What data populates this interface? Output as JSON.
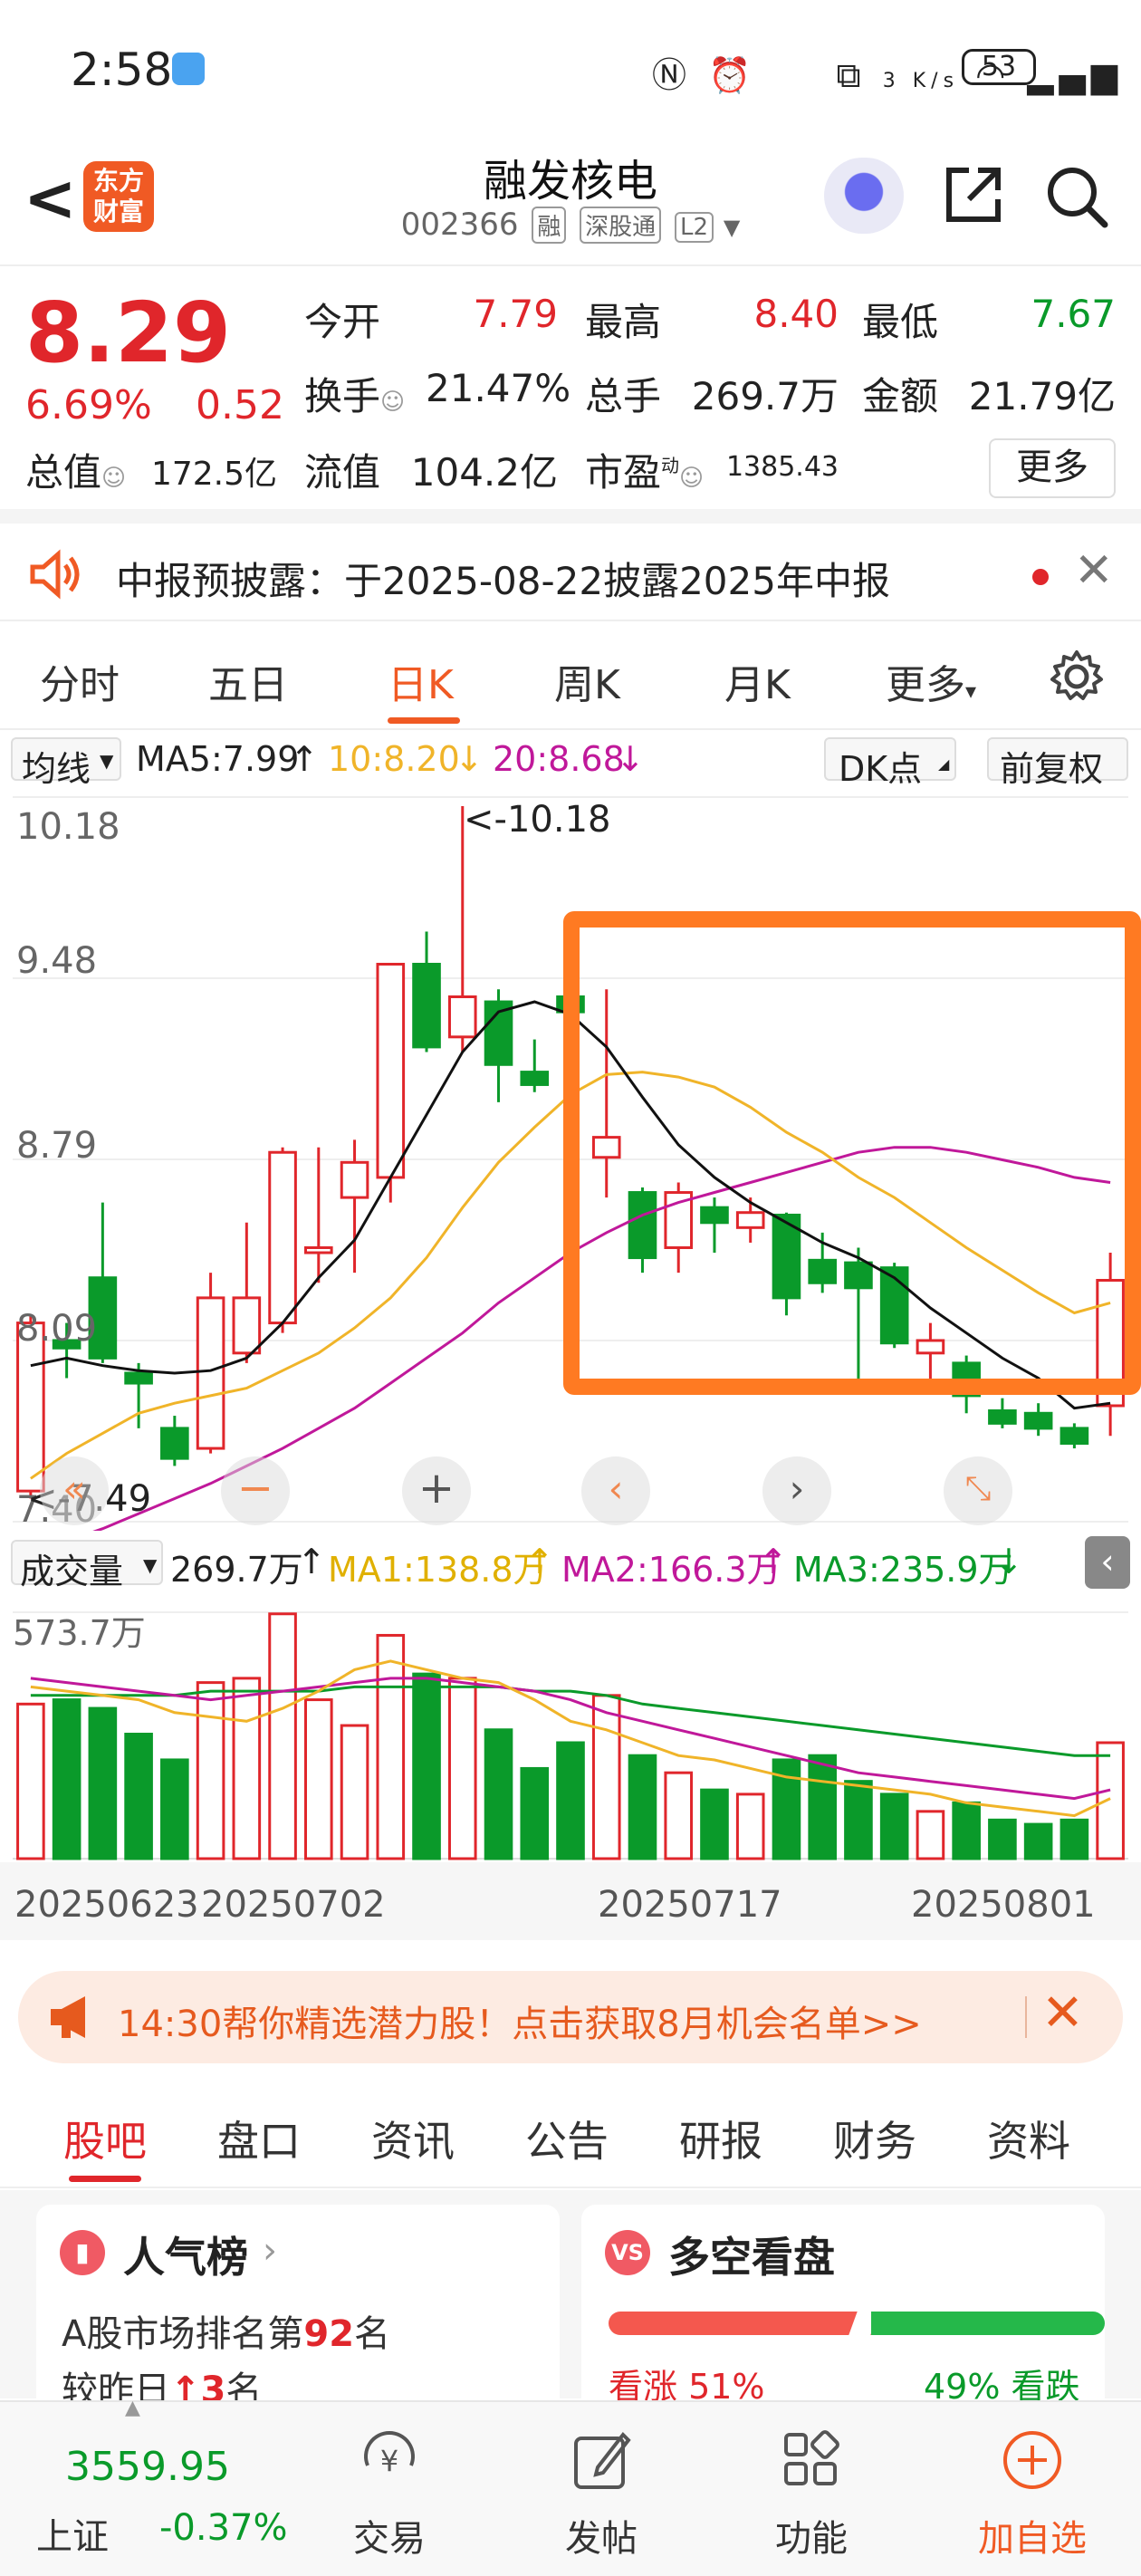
{
  "status_bar": {
    "time": "2:58",
    "net": "3 K/s",
    "battery": "53"
  },
  "header": {
    "logo": "东方财富",
    "title": "融发核电",
    "code": "002366",
    "tags": [
      "融",
      "深股通",
      "L2"
    ]
  },
  "quote": {
    "price": "8.29",
    "change_pct": "6.69%",
    "change": "0.52",
    "rows": [
      [
        {
          "label": "今开",
          "value": "7.79",
          "color": "red"
        },
        {
          "label": "最高",
          "value": "8.40",
          "color": "red"
        },
        {
          "label": "最低",
          "value": "7.67",
          "color": "green"
        }
      ],
      [
        {
          "label": "换手",
          "value": "21.47%"
        },
        {
          "label": "总手",
          "value": "269.7万"
        },
        {
          "label": "金额",
          "value": "21.79亿"
        }
      ],
      [
        {
          "label": "总值",
          "value": "172.5亿"
        },
        {
          "label": "流值",
          "value": "104.2亿"
        },
        {
          "label": "市盈",
          "value": "1385.43",
          "sup": "动"
        }
      ]
    ],
    "more": "更多"
  },
  "notice": {
    "text": "中报预披露：于2025-08-22披露2025年中报"
  },
  "ktabs": [
    "分时",
    "五日",
    "日K",
    "周K",
    "月K",
    "更多"
  ],
  "ma": {
    "selector": "均线",
    "ma5": "MA5:7.99",
    "ma10": "10:8.20",
    "ma20": "20:8.68",
    "dk": "DK点",
    "adj": "前复权"
  },
  "chart_labels": {
    "p1": "10.18",
    "p2": "9.48",
    "p3": "8.79",
    "p4": "8.09",
    "p5": "7.40",
    "hi": "<-10.18",
    "lo": "<-7.49"
  },
  "vol": {
    "selector": "成交量",
    "value": "269.7万",
    "ma1": "MA1:138.8万",
    "ma2": "MA2:166.3万",
    "ma3": "MA3:235.9万",
    "max": "573.7万"
  },
  "dates": [
    "20250623",
    "20250702",
    "20250717",
    "20250801"
  ],
  "colors": {
    "up": "#e0262b",
    "down": "#0a9a2a",
    "ma5": "#111111",
    "ma10": "#f0b429",
    "ma20": "#c0189a",
    "highlight": "#ff7a22"
  },
  "chart_data": {
    "type": "candlestick",
    "candles": [
      {
        "o": 7.45,
        "h": 8.15,
        "l": 7.42,
        "c": 8.12
      },
      {
        "o": 8.05,
        "h": 8.12,
        "l": 7.9,
        "c": 8.02
      },
      {
        "o": 8.3,
        "h": 8.6,
        "l": 7.96,
        "c": 7.98
      },
      {
        "o": 7.92,
        "h": 7.96,
        "l": 7.7,
        "c": 7.88
      },
      {
        "o": 7.7,
        "h": 7.75,
        "l": 7.55,
        "c": 7.58
      },
      {
        "o": 7.62,
        "h": 8.32,
        "l": 7.6,
        "c": 8.22
      },
      {
        "o": 8.0,
        "h": 8.52,
        "l": 7.96,
        "c": 8.22
      },
      {
        "o": 8.12,
        "h": 8.82,
        "l": 8.08,
        "c": 8.8
      },
      {
        "o": 8.4,
        "h": 8.82,
        "l": 8.28,
        "c": 8.42
      },
      {
        "o": 8.62,
        "h": 8.85,
        "l": 8.32,
        "c": 8.76
      },
      {
        "o": 8.7,
        "h": 9.55,
        "l": 8.6,
        "c": 9.55
      },
      {
        "o": 9.55,
        "h": 9.68,
        "l": 9.2,
        "c": 9.22
      },
      {
        "o": 9.26,
        "h": 10.18,
        "l": 9.2,
        "c": 9.42
      },
      {
        "o": 9.4,
        "h": 9.45,
        "l": 9.0,
        "c": 9.15
      },
      {
        "o": 9.12,
        "h": 9.25,
        "l": 9.04,
        "c": 9.07
      },
      {
        "o": 9.42,
        "h": 9.62,
        "l": 9.2,
        "c": 9.36
      },
      {
        "o": 8.78,
        "h": 9.45,
        "l": 8.62,
        "c": 8.86
      },
      {
        "o": 8.64,
        "h": 8.66,
        "l": 8.32,
        "c": 8.38
      },
      {
        "o": 8.42,
        "h": 8.68,
        "l": 8.32,
        "c": 8.64
      },
      {
        "o": 8.58,
        "h": 8.62,
        "l": 8.4,
        "c": 8.52
      },
      {
        "o": 8.5,
        "h": 8.62,
        "l": 8.44,
        "c": 8.56
      },
      {
        "o": 8.55,
        "h": 8.56,
        "l": 8.15,
        "c": 8.22
      },
      {
        "o": 8.37,
        "h": 8.48,
        "l": 8.24,
        "c": 8.28
      },
      {
        "o": 8.36,
        "h": 8.42,
        "l": 7.87,
        "c": 8.26
      },
      {
        "o": 8.34,
        "h": 8.36,
        "l": 8.02,
        "c": 8.04
      },
      {
        "o": 8.0,
        "h": 8.12,
        "l": 7.84,
        "c": 8.05
      },
      {
        "o": 7.96,
        "h": 7.99,
        "l": 7.76,
        "c": 7.83
      },
      {
        "o": 7.77,
        "h": 7.82,
        "l": 7.7,
        "c": 7.72
      },
      {
        "o": 7.76,
        "h": 7.8,
        "l": 7.67,
        "c": 7.7
      },
      {
        "o": 7.7,
        "h": 7.72,
        "l": 7.62,
        "c": 7.64
      },
      {
        "o": 7.79,
        "h": 8.4,
        "l": 7.67,
        "c": 8.29
      }
    ],
    "ma5": [
      7.95,
      7.98,
      7.95,
      7.93,
      7.92,
      7.93,
      7.98,
      8.12,
      8.3,
      8.45,
      8.7,
      8.95,
      9.2,
      9.36,
      9.4,
      9.35,
      9.22,
      9.02,
      8.83,
      8.7,
      8.6,
      8.52,
      8.44,
      8.38,
      8.3,
      8.18,
      8.08,
      7.98,
      7.9,
      7.78,
      7.8
    ],
    "ma10": [
      7.5,
      7.6,
      7.68,
      7.76,
      7.8,
      7.83,
      7.86,
      7.93,
      8.0,
      8.1,
      8.22,
      8.38,
      8.58,
      8.76,
      8.9,
      9.03,
      9.11,
      9.12,
      9.1,
      9.06,
      8.98,
      8.88,
      8.8,
      8.7,
      8.62,
      8.52,
      8.42,
      8.33,
      8.24,
      8.16,
      8.2
    ],
    "ma20": [
      7.2,
      7.25,
      7.3,
      7.36,
      7.42,
      7.48,
      7.55,
      7.62,
      7.7,
      7.78,
      7.88,
      7.98,
      8.08,
      8.2,
      8.3,
      8.4,
      8.48,
      8.55,
      8.6,
      8.64,
      8.68,
      8.72,
      8.76,
      8.8,
      8.82,
      8.82,
      8.8,
      8.77,
      8.74,
      8.7,
      8.68
    ],
    "volumes": [
      3.6,
      3.7,
      3.5,
      2.9,
      2.3,
      4.1,
      4.2,
      5.7,
      3.7,
      3.1,
      5.2,
      4.3,
      4.2,
      3.0,
      2.1,
      2.7,
      3.8,
      2.4,
      2.0,
      1.6,
      1.5,
      2.3,
      2.4,
      1.8,
      1.5,
      1.1,
      1.3,
      0.9,
      0.8,
      0.9,
      2.7
    ],
    "vol_ma1": [
      4.0,
      3.9,
      3.8,
      3.7,
      3.4,
      3.3,
      3.2,
      3.5,
      3.9,
      4.4,
      4.6,
      4.4,
      4.2,
      4.1,
      3.7,
      3.2,
      3.0,
      2.7,
      2.4,
      2.3,
      2.1,
      1.9,
      1.8,
      1.7,
      1.6,
      1.5,
      1.3,
      1.2,
      1.1,
      1.0,
      1.4
    ],
    "vol_ma2": [
      4.2,
      4.1,
      4.0,
      3.9,
      3.8,
      3.7,
      3.8,
      3.9,
      4.0,
      4.1,
      4.2,
      4.2,
      4.1,
      4.0,
      3.9,
      3.7,
      3.4,
      3.2,
      3.0,
      2.8,
      2.6,
      2.4,
      2.2,
      2.0,
      1.9,
      1.8,
      1.7,
      1.6,
      1.5,
      1.4,
      1.6
    ],
    "vol_ma3": [
      3.8,
      3.8,
      3.8,
      3.8,
      3.8,
      3.9,
      3.9,
      3.9,
      3.9,
      4.0,
      4.0,
      4.0,
      4.0,
      4.0,
      3.9,
      3.9,
      3.8,
      3.6,
      3.5,
      3.4,
      3.3,
      3.2,
      3.1,
      3.0,
      2.9,
      2.8,
      2.7,
      2.6,
      2.5,
      2.4,
      2.4
    ],
    "price_range": [
      7.4,
      10.18
    ],
    "volume_max": 5.737
  },
  "promo": {
    "text": "14:30帮你精选潜力股！点击获取8月机会名单>>"
  },
  "btabs": [
    "股吧",
    "盘口",
    "资讯",
    "公告",
    "研报",
    "财务",
    "资料"
  ],
  "cards": {
    "left": {
      "title": "人气榜",
      "line1_a": "A股市场排名第",
      "line1_b": "92",
      "line1_c": "名",
      "line2_a": "较昨日",
      "line2_b": "3",
      "line2_c": "名"
    },
    "right": {
      "title": "多空看盘",
      "bull": "看涨 51%",
      "bear": "49% 看跌",
      "bull_pct": 51
    }
  },
  "bnav": {
    "index_value": "3559.95",
    "index_name": "上证",
    "index_chg": "-0.37%",
    "items": [
      "交易",
      "发帖",
      "功能",
      "加自选"
    ]
  }
}
